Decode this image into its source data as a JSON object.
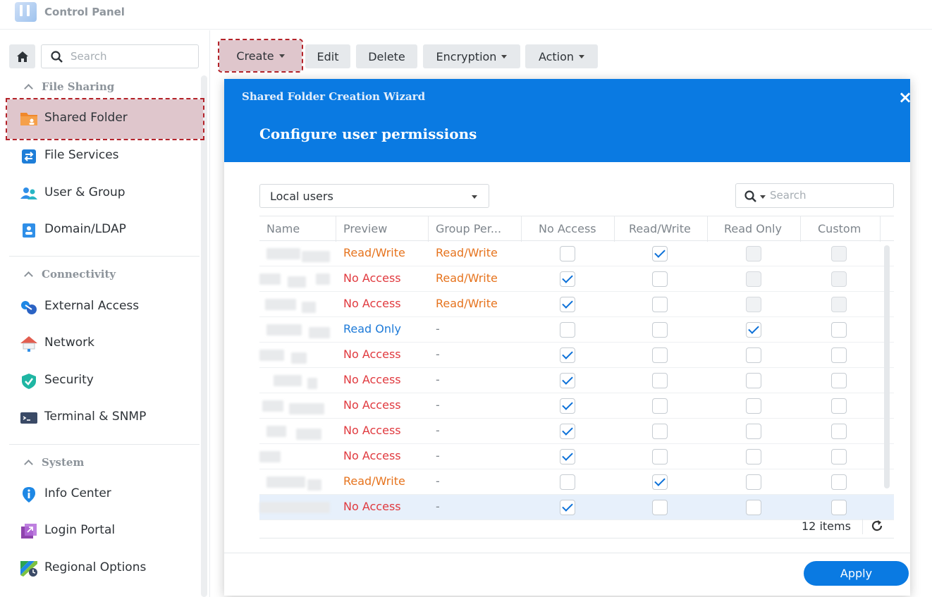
{
  "app": {
    "title": "Control Panel",
    "icon": "control-panel-icon"
  },
  "sidebar": {
    "search_placeholder": "Search",
    "sections": [
      {
        "title": "File Sharing",
        "items": [
          {
            "label": "Shared Folder",
            "icon": "shared-folder-icon",
            "color": "#f0882a",
            "active": true
          },
          {
            "label": "File Services",
            "icon": "file-services-icon",
            "color": "#1e7ed8"
          },
          {
            "label": "User & Group",
            "icon": "user-group-icon",
            "color": "#27b5c4"
          },
          {
            "label": "Domain/LDAP",
            "icon": "domain-ldap-icon",
            "color": "#2f8fe8"
          }
        ]
      },
      {
        "title": "Connectivity",
        "items": [
          {
            "label": "External Access",
            "icon": "external-access-icon",
            "color": "#1e88e5"
          },
          {
            "label": "Network",
            "icon": "network-icon",
            "color": "#e25d4f"
          },
          {
            "label": "Security",
            "icon": "security-icon",
            "color": "#1fb6a3"
          },
          {
            "label": "Terminal & SNMP",
            "icon": "terminal-icon",
            "color": "#3a4a66"
          }
        ]
      },
      {
        "title": "System",
        "items": [
          {
            "label": "Info Center",
            "icon": "info-icon",
            "color": "#1e88e5"
          },
          {
            "label": "Login Portal",
            "icon": "login-portal-icon",
            "color": "#8e44ad"
          },
          {
            "label": "Regional Options",
            "icon": "regional-options-icon",
            "color": "#2ea44f"
          }
        ]
      }
    ]
  },
  "toolbar": {
    "create": "Create",
    "edit": "Edit",
    "delete": "Delete",
    "encryption": "Encryption",
    "action": "Action"
  },
  "wizard": {
    "window_title": "Shared Folder Creation Wizard",
    "step_title": "Configure user permissions",
    "user_type": "Local users",
    "search_placeholder": "Search",
    "columns": [
      "Name",
      "Preview",
      "Group Per...",
      "No Access",
      "Read/Write",
      "Read Only",
      "Custom"
    ],
    "rows": [
      {
        "preview": "Read/Write",
        "group": "Read/Write",
        "perm": "read_write",
        "locked": true
      },
      {
        "preview": "No Access",
        "group": "Read/Write",
        "perm": "no_access",
        "locked": true
      },
      {
        "preview": "No Access",
        "group": "Read/Write",
        "perm": "no_access",
        "locked": true
      },
      {
        "preview": "Read Only",
        "group": "-",
        "perm": "read_only",
        "locked": false
      },
      {
        "preview": "No Access",
        "group": "-",
        "perm": "no_access",
        "locked": false
      },
      {
        "preview": "No Access",
        "group": "-",
        "perm": "no_access",
        "locked": false
      },
      {
        "preview": "No Access",
        "group": "-",
        "perm": "no_access",
        "locked": false
      },
      {
        "preview": "No Access",
        "group": "-",
        "perm": "no_access",
        "locked": false
      },
      {
        "preview": "No Access",
        "group": "-",
        "perm": "no_access",
        "locked": false
      },
      {
        "preview": "Read/Write",
        "group": "-",
        "perm": "read_write",
        "locked": false
      },
      {
        "preview": "No Access",
        "group": "-",
        "perm": "no_access",
        "locked": false,
        "selected": true
      }
    ],
    "items_count": "12 items",
    "apply": "Apply"
  },
  "colors": {
    "accent": "#0a7ae2",
    "read_write": "#e6731d",
    "no_access": "#e0393e",
    "read_only": "#1d7ad8",
    "highlight": "#dfc6cc"
  }
}
